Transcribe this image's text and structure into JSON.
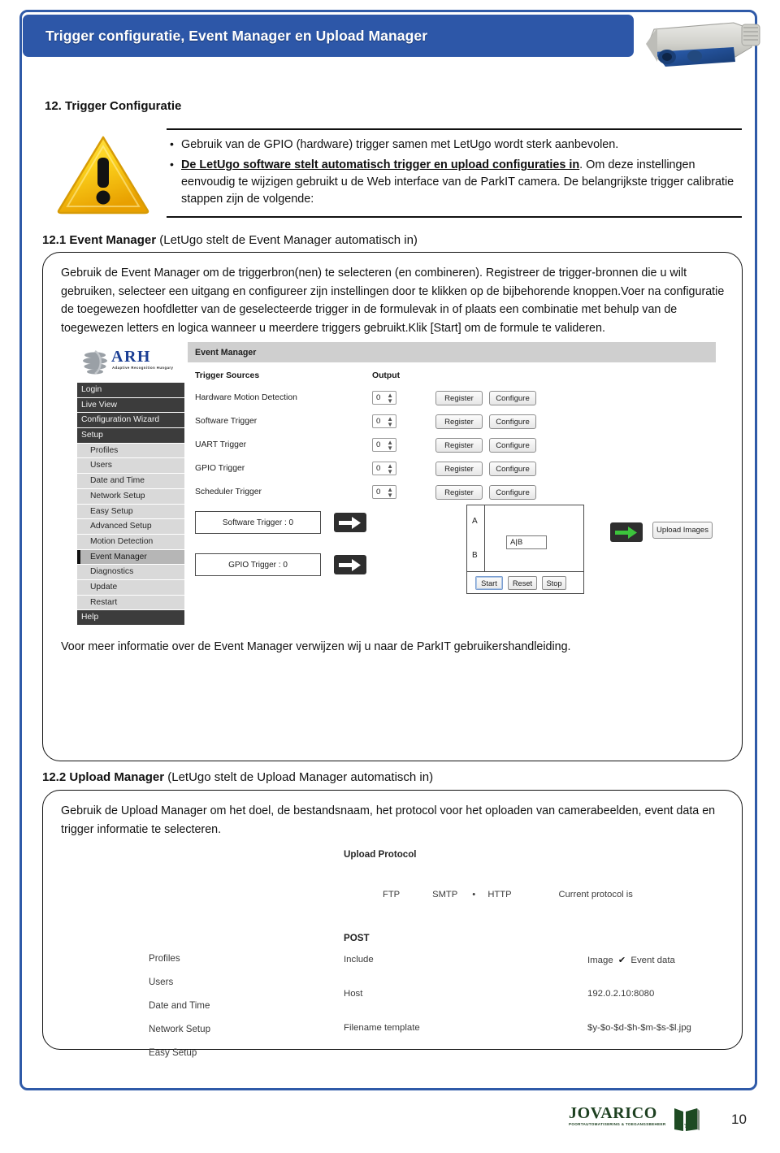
{
  "header": {
    "title": "Trigger configuratie, Event Manager en Upload Manager",
    "camera_icon": "security-camera-image",
    "accent_color": "#2d57a8"
  },
  "section12": {
    "heading": "12. Trigger Configuratie",
    "warning_icon": "warning-triangle-icon",
    "bullets": [
      {
        "plain_before": "Gebruik van de GPIO (hardware) trigger samen met LetUgo wordt sterk aanbevolen.",
        "bold_underline": "",
        "plain_after": ""
      },
      {
        "plain_before": "",
        "bold_underline": "De LetUgo software stelt automatisch trigger en upload configuraties in",
        "plain_after": ". Om deze instellingen eenvoudig te wijzigen gebruikt u de Web interface van de ParkIT camera. De belangrijkste trigger calibratie stappen zijn de volgende:"
      }
    ]
  },
  "section121": {
    "number": "12.1",
    "title": "Event Manager",
    "note": "(LetUgo stelt de Event Manager automatisch in)",
    "paragraph": "Gebruik de Event Manager om de triggerbron(nen) te selecteren (en combineren). Registreer de trigger-bronnen die u wilt gebruiken, selecteer een uitgang en configureer zijn instellingen door te klikken op de bijbehorende knoppen.Voer na configuratie de toegewezen hoofdletter van de geselecteerde trigger in de formulevak in of plaats een combinatie met behulp van de toegewezen letters en logica wanneer u meerdere triggers gebruikt.Klik [Start] om de formule te valideren.",
    "footnote": "Voor meer informatie over de Event Manager verwijzen wij u naar de ParkIT gebruikershandleiding."
  },
  "event_manager_app": {
    "logo": {
      "word": "ARH",
      "subtitle": "Adaptive Recognition Hungary",
      "globe_icon": "arh-globe-icon",
      "color": "#1c3f94"
    },
    "sidebar": [
      {
        "label": "Login",
        "style": "dark",
        "selected": false
      },
      {
        "label": "Live View",
        "style": "dark",
        "selected": false
      },
      {
        "label": "Configuration Wizard",
        "style": "dark",
        "selected": false
      },
      {
        "label": "Setup",
        "style": "dark",
        "selected": false
      },
      {
        "label": "Profiles",
        "style": "light",
        "selected": false
      },
      {
        "label": "Users",
        "style": "light",
        "selected": false
      },
      {
        "label": "Date and Time",
        "style": "light",
        "selected": false
      },
      {
        "label": "Network Setup",
        "style": "light",
        "selected": false
      },
      {
        "label": "Easy Setup",
        "style": "light",
        "selected": false
      },
      {
        "label": "Advanced Setup",
        "style": "light",
        "selected": false
      },
      {
        "label": "Motion Detection",
        "style": "light",
        "selected": false
      },
      {
        "label": "Event Manager",
        "style": "sel",
        "selected": true
      },
      {
        "label": "Diagnostics",
        "style": "light",
        "selected": false
      },
      {
        "label": "Update",
        "style": "light",
        "selected": false
      },
      {
        "label": "Restart",
        "style": "light",
        "selected": false
      },
      {
        "label": "Help",
        "style": "dark",
        "selected": false
      }
    ],
    "titlebar": "Event Manager",
    "columns": {
      "sources": "Trigger Sources",
      "output": "Output"
    },
    "rows": [
      {
        "name": "Hardware Motion Detection",
        "output": "0",
        "register": "Register",
        "configure": "Configure"
      },
      {
        "name": "Software Trigger",
        "output": "0",
        "register": "Register",
        "configure": "Configure"
      },
      {
        "name": "UART Trigger",
        "output": "0",
        "register": "Register",
        "configure": "Configure"
      },
      {
        "name": "GPIO Trigger",
        "output": "0",
        "register": "Register",
        "configure": "Configure"
      },
      {
        "name": "Scheduler Trigger",
        "output": "0",
        "register": "Register",
        "configure": "Configure"
      }
    ],
    "formula": {
      "source_a": "Software Trigger : 0",
      "source_b": "GPIO Trigger : 0",
      "label_a": "A",
      "label_b": "B",
      "expression": "A|B",
      "start": "Start",
      "reset": "Reset",
      "stop": "Stop",
      "upload_button": "Upload Images",
      "arrow_color_dark": "#2e2e2e",
      "arrow_color_green": "#3cc43c"
    }
  },
  "section122": {
    "number": "12.2",
    "title": "Upload Manager",
    "note": "(LetUgo stelt de Upload Manager automatisch in)",
    "paragraph": "Gebruik de Upload Manager om het doel, de bestandsnaam, het protocol voor het oploaden van camerabeelden, event data en trigger informatie te selecteren."
  },
  "upload_manager_app": {
    "heading": "Upload Protocol",
    "protocols": [
      "FTP",
      "SMTP",
      "HTTP"
    ],
    "selected_protocol": "HTTP",
    "current_protocol_label": "Current protocol is",
    "method": "POST",
    "sidebar": [
      "Profiles",
      "Users",
      "Date and Time",
      "Network Setup",
      "Easy Setup"
    ],
    "fields": [
      {
        "key": "Include",
        "value_parts": [
          "Image",
          "Event data"
        ],
        "checked": "Image"
      },
      {
        "key": "Host",
        "value": "192.0.2.10:8080"
      },
      {
        "key": "Filename template",
        "value": "$y-$o-$d-$h-$m-$s-$l.jpg"
      }
    ]
  },
  "footer": {
    "logo_word": "JOVARICO",
    "logo_subtitle": "POORTAUTOMATISERING & TOEGANGSBEHEER",
    "logo_mark": "gate-door-icon",
    "page_number": "10"
  }
}
